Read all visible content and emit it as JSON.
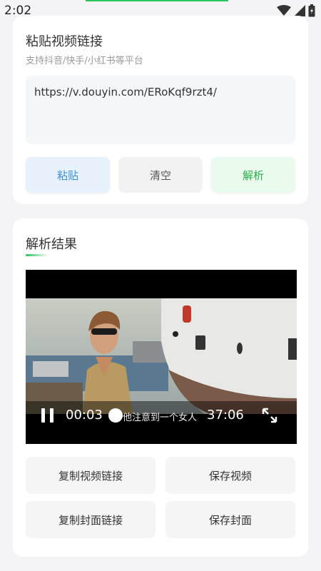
{
  "status_bar": {
    "time": "2:02",
    "icons": [
      "wifi-icon",
      "signal-icon",
      "battery-icon"
    ]
  },
  "input_card": {
    "title": "粘贴视频链接",
    "subtitle": "支持抖音/快手/小红书等平台",
    "url_value": "https://v.douyin.com/ERoKqf9rzt4/",
    "buttons": {
      "paste": "粘贴",
      "clear": "清空",
      "parse": "解析"
    }
  },
  "result_card": {
    "title": "解析结果",
    "video": {
      "current_time": "00:03",
      "total_time": "37:06",
      "subtitle": "他注意到一个女人",
      "progress": 0.0013
    },
    "actions": {
      "copy_video_link": "复制视频链接",
      "save_video": "保存视频",
      "copy_cover_link": "复制封面链接",
      "save_cover": "保存封面"
    }
  },
  "colors": {
    "accent_green": "#29c45a",
    "paste_blue": "#3a8ee6",
    "background": "#f4f4f6"
  }
}
